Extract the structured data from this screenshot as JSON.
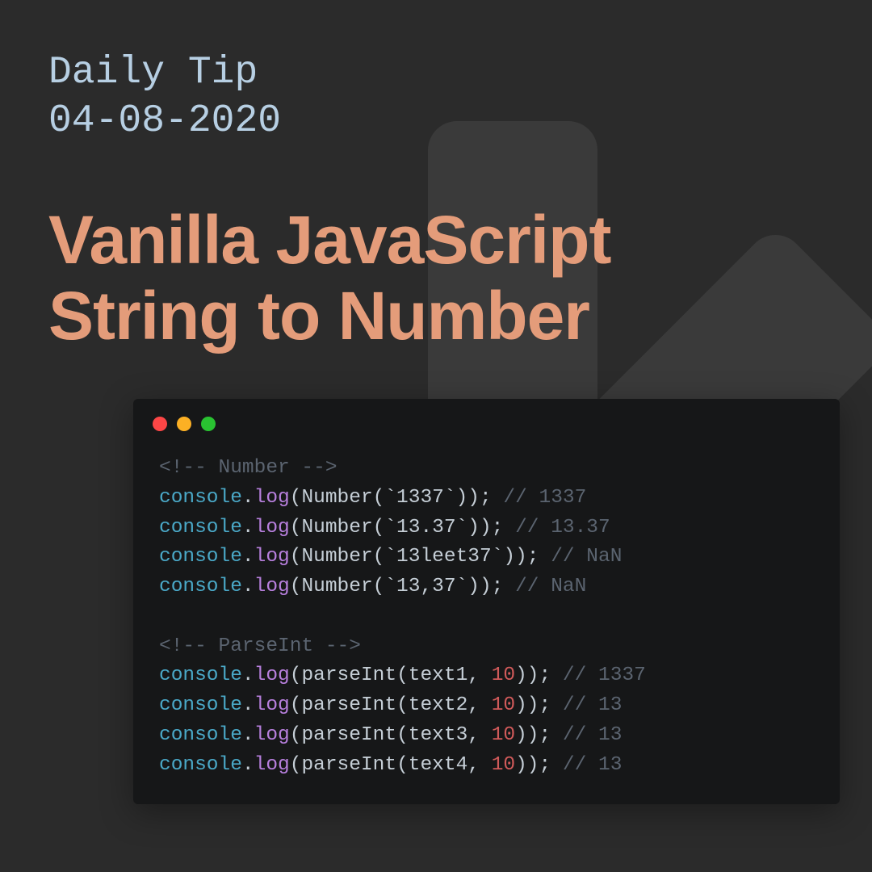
{
  "header": {
    "line1": "Daily Tip",
    "line2": "04-08-2020"
  },
  "title": {
    "line1": "Vanilla JavaScript",
    "line2": "String to Number"
  },
  "code": {
    "section1_comment": "<!-- Number -->",
    "lines_number": [
      {
        "obj": "console",
        "fn": "log",
        "call": "Number",
        "arg_str": "`1337`",
        "comment": "// 1337"
      },
      {
        "obj": "console",
        "fn": "log",
        "call": "Number",
        "arg_str": "`13.37`",
        "comment": "// 13.37"
      },
      {
        "obj": "console",
        "fn": "log",
        "call": "Number",
        "arg_str": "`13leet37`",
        "comment": "// NaN"
      },
      {
        "obj": "console",
        "fn": "log",
        "call": "Number",
        "arg_str": "`13,37`",
        "comment": "// NaN"
      }
    ],
    "section2_comment": "<!-- ParseInt -->",
    "lines_parseint": [
      {
        "obj": "console",
        "fn": "log",
        "call": "parseInt",
        "arg_var": "text1",
        "arg_num": "10",
        "comment": "// 1337"
      },
      {
        "obj": "console",
        "fn": "log",
        "call": "parseInt",
        "arg_var": "text2",
        "arg_num": "10",
        "comment": "// 13"
      },
      {
        "obj": "console",
        "fn": "log",
        "call": "parseInt",
        "arg_var": "text3",
        "arg_num": "10",
        "comment": "// 13"
      },
      {
        "obj": "console",
        "fn": "log",
        "call": "parseInt",
        "arg_var": "text4",
        "arg_num": "10",
        "comment": "// 13"
      }
    ]
  }
}
